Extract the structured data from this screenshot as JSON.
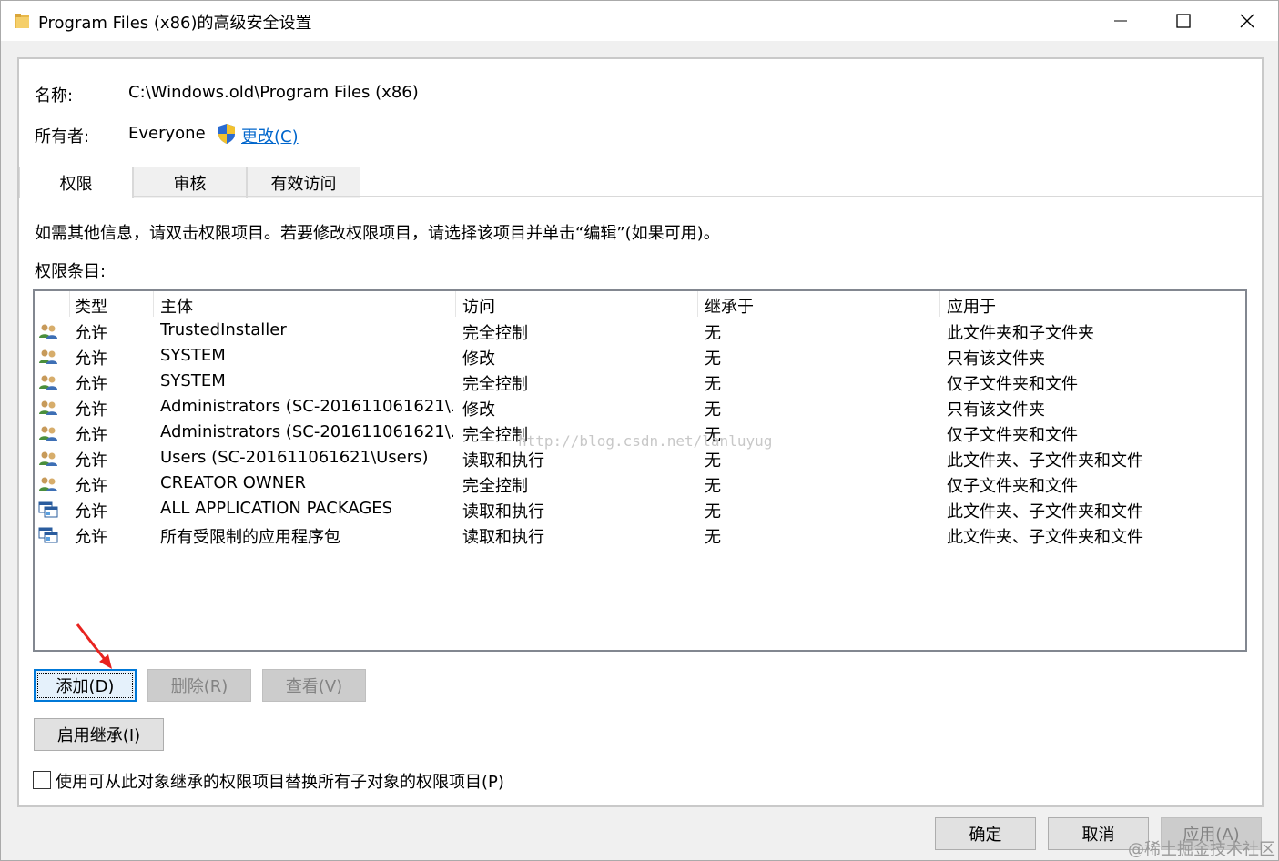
{
  "window": {
    "title": "Program Files (x86)的高级安全设置"
  },
  "info": {
    "name_label": "名称:",
    "name_value": "C:\\Windows.old\\Program Files (x86)",
    "owner_label": "所有者:",
    "owner_value": "Everyone",
    "change_link": "更改(C)"
  },
  "tabs": [
    {
      "label": "权限",
      "active": true
    },
    {
      "label": "审核",
      "active": false
    },
    {
      "label": "有效访问",
      "active": false
    }
  ],
  "instructions": "如需其他信息，请双击权限项目。若要修改权限项目，请选择该项目并单击“编辑”(如果可用)。",
  "entries_label": "权限条目:",
  "columns": [
    "类型",
    "主体",
    "访问",
    "继承于",
    "应用于"
  ],
  "rows": [
    {
      "icon": "users-icon",
      "type": "允许",
      "principal": "TrustedInstaller",
      "access": "完全控制",
      "inherited": "无",
      "applies": "此文件夹和子文件夹"
    },
    {
      "icon": "users-icon",
      "type": "允许",
      "principal": "SYSTEM",
      "access": "修改",
      "inherited": "无",
      "applies": "只有该文件夹"
    },
    {
      "icon": "users-icon",
      "type": "允许",
      "principal": "SYSTEM",
      "access": "完全控制",
      "inherited": "无",
      "applies": "仅子文件夹和文件"
    },
    {
      "icon": "users-icon",
      "type": "允许",
      "principal": "Administrators (SC-201611061621\\...",
      "access": "修改",
      "inherited": "无",
      "applies": "只有该文件夹"
    },
    {
      "icon": "users-icon",
      "type": "允许",
      "principal": "Administrators (SC-201611061621\\...",
      "access": "完全控制",
      "inherited": "无",
      "applies": "仅子文件夹和文件"
    },
    {
      "icon": "users-icon",
      "type": "允许",
      "principal": "Users (SC-201611061621\\Users)",
      "access": "读取和执行",
      "inherited": "无",
      "applies": "此文件夹、子文件夹和文件"
    },
    {
      "icon": "users-icon",
      "type": "允许",
      "principal": "CREATOR OWNER",
      "access": "完全控制",
      "inherited": "无",
      "applies": "仅子文件夹和文件"
    },
    {
      "icon": "app-packages-icon",
      "type": "允许",
      "principal": "ALL APPLICATION PACKAGES",
      "access": "读取和执行",
      "inherited": "无",
      "applies": "此文件夹、子文件夹和文件"
    },
    {
      "icon": "app-packages-icon",
      "type": "允许",
      "principal": "所有受限制的应用程序包",
      "access": "读取和执行",
      "inherited": "无",
      "applies": "此文件夹、子文件夹和文件"
    }
  ],
  "buttons": {
    "add": "添加(D)",
    "remove": "删除(R)",
    "view": "查看(V)",
    "enable_inheritance": "启用继承(I)",
    "ok": "确定",
    "cancel": "取消",
    "apply": "应用(A)"
  },
  "replace_checkbox": {
    "label": "使用可从此对象继承的权限项目替换所有子对象的权限项目(P)",
    "checked": false
  },
  "watermarks": {
    "center": "http://blog.csdn.net/lanluyug",
    "corner": "@稀土掘金技术社区"
  },
  "colors": {
    "accent": "#0078d7",
    "link": "#0066cc",
    "annotation_arrow": "#e8231f"
  }
}
